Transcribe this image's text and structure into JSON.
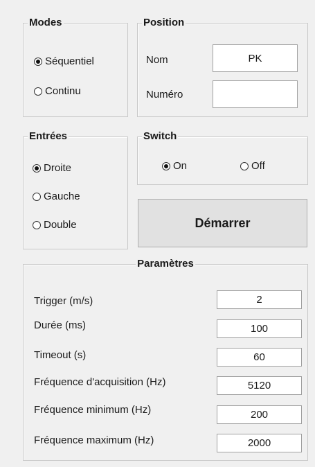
{
  "modes": {
    "title": "Modes",
    "options": [
      {
        "label": "Séquentiel",
        "checked": true
      },
      {
        "label": "Continu",
        "checked": false
      }
    ]
  },
  "position": {
    "title": "Position",
    "nom_label": "Nom",
    "nom_value": "PK",
    "numero_label": "Numéro",
    "numero_value": ""
  },
  "entrees": {
    "title": "Entrées",
    "options": [
      {
        "label": "Droite",
        "checked": true
      },
      {
        "label": "Gauche",
        "checked": false
      },
      {
        "label": "Double",
        "checked": false
      }
    ]
  },
  "switch": {
    "title": "Switch",
    "options": [
      {
        "label": "On",
        "checked": true
      },
      {
        "label": "Off",
        "checked": false
      }
    ]
  },
  "start_button": {
    "label": "Démarrer"
  },
  "parametres": {
    "title": "Paramètres",
    "rows": [
      {
        "label": "Trigger (m/s)",
        "value": "2"
      },
      {
        "label": "Durée (ms)",
        "value": "100"
      },
      {
        "label": "Timeout (s)",
        "value": "60"
      },
      {
        "label": "Fréquence d'acquisition (Hz)",
        "value": "5120"
      },
      {
        "label": "Fréquence minimum (Hz)",
        "value": "200"
      },
      {
        "label": "Fréquence maximum (Hz)",
        "value": "2000"
      }
    ]
  }
}
